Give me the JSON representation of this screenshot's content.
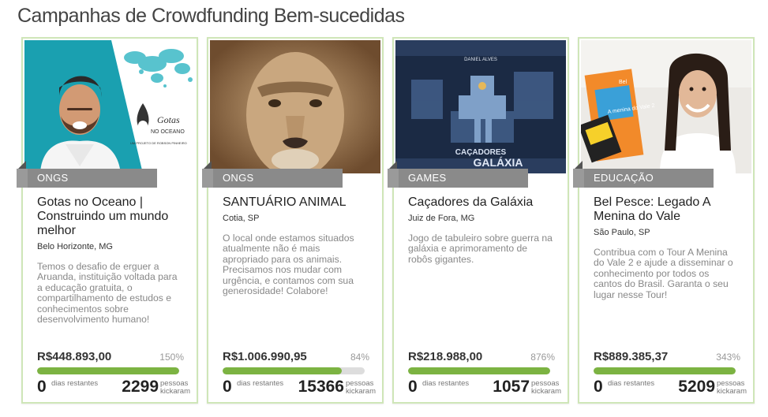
{
  "page": {
    "title": "Campanhas de Crowdfunding Bem-sucedidas"
  },
  "cards": [
    {
      "category": "ONGS",
      "name": "Gotas no Oceano | Construindo um mundo melhor",
      "location": "Belo Horizonte, MG",
      "description": "Temos o desafio de erguer a Aruanda, instituição voltada para a educação gratuita, o compartilhamento de estudos e conhecimentos sobre desenvolvimento humano!",
      "amount": "R$448.893,00",
      "percent": "150%",
      "progress": 1.0,
      "days": "0",
      "days_label": "dias restantes",
      "backers": "2299",
      "backers_label": "pessoas kickaram",
      "image_text": {
        "logo": "Gotas",
        "logo2": "NO OCEANO",
        "credit": "UM PROJETO DE ROBSON PINHEIRO"
      }
    },
    {
      "category": "ONGS",
      "name": "SANTUÁRIO ANIMAL",
      "location": "Cotia, SP",
      "description": "O local onde estamos situados atualmente não é mais apropriado para os animais. Precisamos nos mudar com urgência, e contamos com sua generosidade! Colabore!",
      "amount": "R$1.006.990,95",
      "percent": "84%",
      "progress": 0.84,
      "days": "0",
      "days_label": "dias restantes",
      "backers": "15366",
      "backers_label": "pessoas kickaram",
      "image_text": {}
    },
    {
      "category": "GAMES",
      "name": "Caçadores da Galáxia",
      "location": "Juiz de Fora, MG",
      "description": "Jogo de tabuleiro sobre guerra na galáxia e aprimoramento de robôs gigantes.",
      "amount": "R$218.988,00",
      "percent": "876%",
      "progress": 1.0,
      "days": "0",
      "days_label": "dias restantes",
      "backers": "1057",
      "backers_label": "pessoas kickaram",
      "image_text": {
        "author": "DANIEL ALVES",
        "line1": "CAÇADORES",
        "line2": "GALÁXIA"
      }
    },
    {
      "category": "EDUCAÇÃO",
      "name": "Bel Pesce: Legado A Menina do Vale",
      "location": "São Paulo, SP",
      "description": "Contribua com o Tour A Menina do Vale 2 e ajude a disseminar o conhecimento por todos os cantos do Brasil. Garanta o seu lugar nesse Tour!",
      "amount": "R$889.385,37",
      "percent": "343%",
      "progress": 1.0,
      "days": "0",
      "days_label": "dias restantes",
      "backers": "5209",
      "backers_label": "pessoas kickaram",
      "image_text": {
        "book_top": "Bel",
        "book": "A menina do Vale 2"
      }
    }
  ],
  "colors": {
    "accent": "#7cb342",
    "card_border": "#cfe6b8",
    "tag": "#8a8a8a"
  }
}
